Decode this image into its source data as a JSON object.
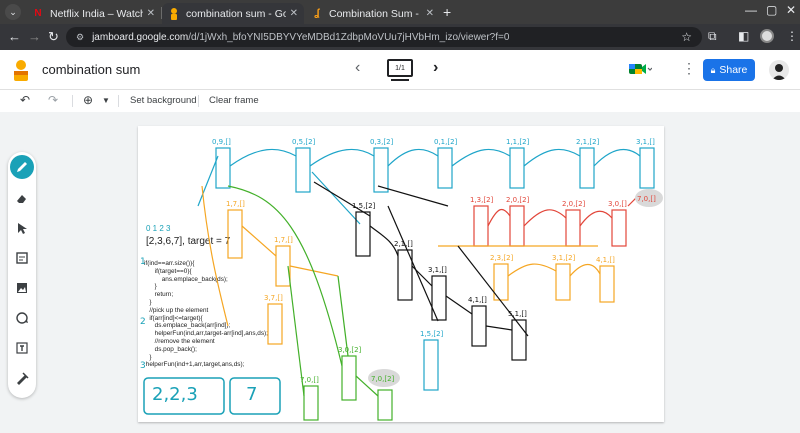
{
  "browser": {
    "tabs": [
      {
        "title": "Netflix India – Watch TV",
        "favicon": "netflix-icon",
        "active": false
      },
      {
        "title": "combination sum - Goog",
        "favicon": "jamboard-icon",
        "active": true
      },
      {
        "title": "Combination Sum - Leet",
        "favicon": "leetcode-icon",
        "active": false
      }
    ],
    "url": "jamboard.google.com/d/1jWxh_bfoYNI5DBYVYeMDBd1ZdbpMoVUu7jHVbHm_izo/viewer?f=0",
    "url_host": "jamboard.google.com",
    "url_path": "/d/1jWxh_bfoYNI5DBYVYeMDBd1ZdbpMoVUu7jHVbHm_izo/viewer?f=0"
  },
  "app": {
    "title": "combination sum",
    "frame_indicator": "1/1",
    "share_label": "Share"
  },
  "toolbar": {
    "set_background": "Set background",
    "clear_frame": "Clear frame"
  },
  "board": {
    "array_line": "[2,3,6,7], target = 7",
    "index_note": "0 1 2 3",
    "code": "if(ind==arr.size()){\n      if(target==0){\n          ans.emplace_back(ds);\n      }\n      return;\n   }\n   //pick up the element\n   if(arr[ind]<=target){\n      ds.emplace_back(arr[ind]);\n      helperFun(ind,arr,target-arr[ind],ans,ds);\n      //remove the element\n      ds.pop_back();\n   }\n helperFun(ind+1,arr,target,ans,ds);",
    "answers": [
      "2,2,3",
      "7"
    ]
  },
  "colors": {
    "accent": "#1a73e8",
    "teal": "#1aa1b7",
    "tree_blue": "#1ea5c9",
    "tree_orange": "#f5a623",
    "tree_red": "#e2463a",
    "tree_green": "#43b02a",
    "tree_black": "#111111"
  }
}
